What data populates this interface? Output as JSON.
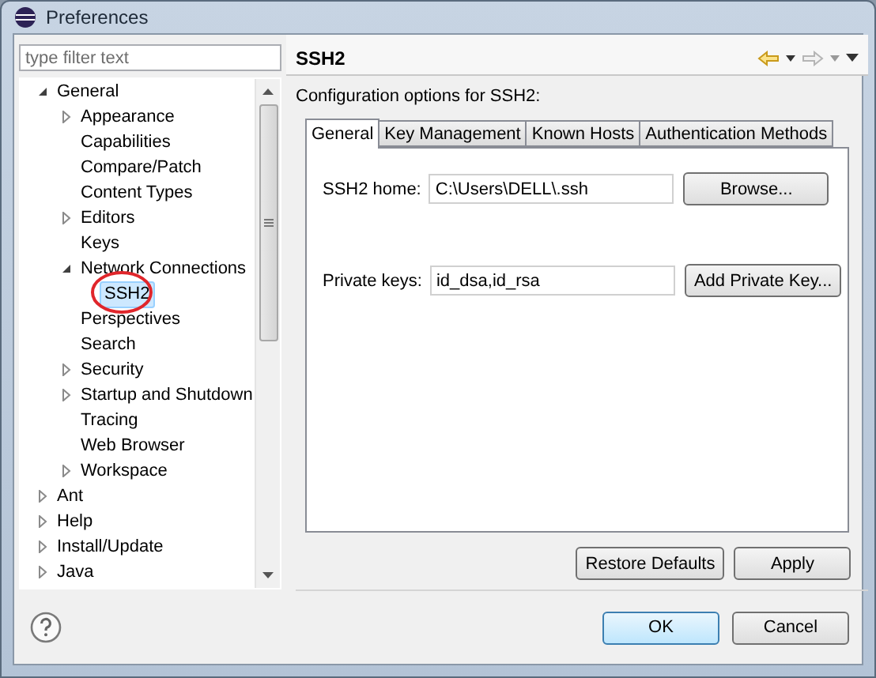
{
  "window": {
    "title": "Preferences"
  },
  "filter": {
    "placeholder": "type filter text"
  },
  "tree": [
    {
      "label": "General",
      "kind": "branch",
      "expanded": true,
      "selected": false,
      "children": [
        {
          "label": "Appearance",
          "kind": "branch",
          "expanded": false,
          "selected": false
        },
        {
          "label": "Capabilities",
          "kind": "leaf",
          "selected": false
        },
        {
          "label": "Compare/Patch",
          "kind": "leaf",
          "selected": false
        },
        {
          "label": "Content Types",
          "kind": "leaf",
          "selected": false
        },
        {
          "label": "Editors",
          "kind": "branch",
          "expanded": false,
          "selected": false
        },
        {
          "label": "Keys",
          "kind": "leaf",
          "selected": false
        },
        {
          "label": "Network Connections",
          "kind": "branch",
          "expanded": true,
          "selected": false,
          "children": [
            {
              "label": "SSH2",
              "kind": "leaf",
              "selected": true,
              "circled": true
            }
          ]
        },
        {
          "label": "Perspectives",
          "kind": "leaf",
          "selected": false
        },
        {
          "label": "Search",
          "kind": "leaf",
          "selected": false
        },
        {
          "label": "Security",
          "kind": "branch",
          "expanded": false,
          "selected": false
        },
        {
          "label": "Startup and Shutdown",
          "kind": "branch",
          "expanded": false,
          "selected": false
        },
        {
          "label": "Tracing",
          "kind": "leaf",
          "selected": false
        },
        {
          "label": "Web Browser",
          "kind": "leaf",
          "selected": false
        },
        {
          "label": "Workspace",
          "kind": "branch",
          "expanded": false,
          "selected": false
        }
      ]
    },
    {
      "label": "Ant",
      "kind": "branch",
      "expanded": false,
      "selected": false
    },
    {
      "label": "Help",
      "kind": "branch",
      "expanded": false,
      "selected": false
    },
    {
      "label": "Install/Update",
      "kind": "branch",
      "expanded": false,
      "selected": false
    },
    {
      "label": "Java",
      "kind": "branch",
      "expanded": false,
      "selected": false
    }
  ],
  "page": {
    "title": "SSH2",
    "description": "Configuration options for SSH2:",
    "tabs": [
      {
        "label": "General",
        "selected": true
      },
      {
        "label": "Key Management",
        "selected": false
      },
      {
        "label": "Known Hosts",
        "selected": false
      },
      {
        "label": "Authentication Methods",
        "selected": false
      }
    ],
    "fields": [
      {
        "label": "SSH2 home:",
        "value": "C:\\Users\\DELL\\.ssh",
        "button": "Browse..."
      },
      {
        "label": "Private keys:",
        "value": "id_dsa,id_rsa",
        "button": "Add Private Key..."
      }
    ],
    "buttons": [
      "Restore Defaults",
      "Apply"
    ]
  },
  "dialog_buttons": [
    {
      "label": "OK",
      "default": true
    },
    {
      "label": "Cancel",
      "default": false
    }
  ]
}
